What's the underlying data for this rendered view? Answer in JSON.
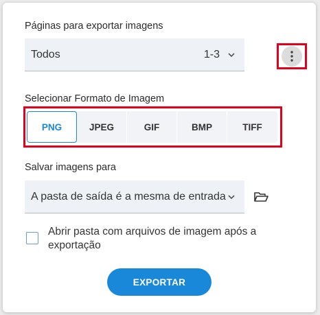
{
  "pages": {
    "label": "Páginas para exportar imagens",
    "selected": "Todos",
    "range": "1-3"
  },
  "format": {
    "label": "Selecionar Formato de Imagem",
    "options": [
      "PNG",
      "JPEG",
      "GIF",
      "BMP",
      "TIFF"
    ],
    "selected": "PNG"
  },
  "save": {
    "label": "Salvar imagens para",
    "selected": "A pasta de saída é a mesma de entrada"
  },
  "open_folder": {
    "label": "Abrir pasta com arquivos de imagem após a exportação",
    "checked": false
  },
  "export_button": "EXPORTAR",
  "colors": {
    "accent": "#1a88d8",
    "highlight": "#e3001b"
  },
  "icons": {
    "more": "more-vertical-icon",
    "dropdown": "chevron-down-icon",
    "folder": "folder-open-icon"
  }
}
